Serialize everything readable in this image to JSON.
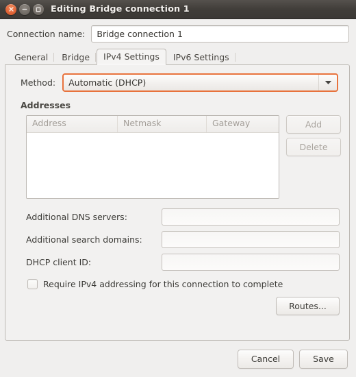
{
  "window": {
    "title": "Editing Bridge connection 1",
    "controls": {
      "close": "close-icon",
      "minimize": "minimize-icon",
      "maximize": "maximize-icon"
    },
    "accent_color": "#e2663a",
    "titlebar_color": "#403d39",
    "background_color": "#f0efee"
  },
  "connection_name": {
    "label": "Connection name:",
    "value": "Bridge connection 1",
    "placeholder": ""
  },
  "tabs": [
    {
      "label": "General",
      "active": false
    },
    {
      "label": "Bridge",
      "active": false
    },
    {
      "label": "IPv4 Settings",
      "active": true
    },
    {
      "label": "IPv6 Settings",
      "active": false
    }
  ],
  "ipv4": {
    "method": {
      "label": "Method:",
      "value": "Automatic (DHCP)",
      "arrow": "chevron-down-icon"
    },
    "addresses": {
      "title": "Addresses",
      "columns": [
        "Address",
        "Netmask",
        "Gateway"
      ],
      "rows": [],
      "add_label": "Add",
      "delete_label": "Delete",
      "add_enabled": false,
      "delete_enabled": false
    },
    "fields": [
      {
        "label": "Additional DNS servers:",
        "value": "",
        "placeholder": ""
      },
      {
        "label": "Additional search domains:",
        "value": "",
        "placeholder": ""
      },
      {
        "label": "DHCP client ID:",
        "value": "",
        "placeholder": ""
      }
    ],
    "require_ipv4": {
      "label": "Require IPv4 addressing for this connection to complete",
      "checked": false
    },
    "routes_label": "Routes..."
  },
  "actions": {
    "cancel_label": "Cancel",
    "save_label": "Save"
  }
}
